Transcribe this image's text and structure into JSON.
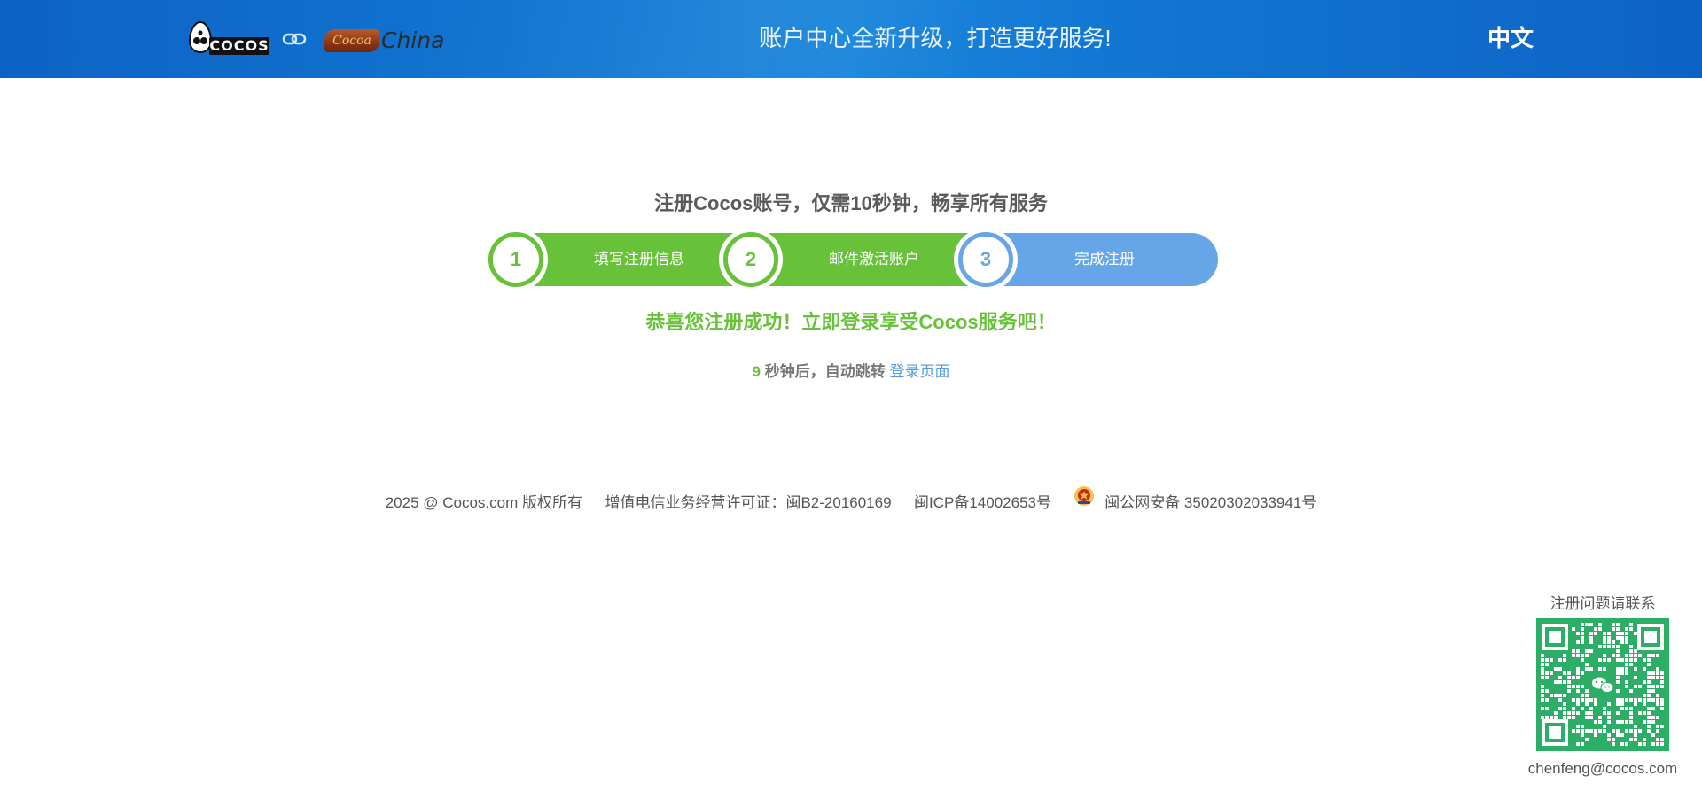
{
  "header": {
    "logo_cocos_text": "COCOS",
    "logo_cocoa_text": "Cocoa",
    "logo_china_text": "China",
    "slogan": "账户中心全新升级，打造更好服务!",
    "language": "中文"
  },
  "main": {
    "title": "注册Cocos账号，仅需10秒钟，畅享所有服务",
    "steps": [
      {
        "number": "1",
        "label": "填写注册信息"
      },
      {
        "number": "2",
        "label": "邮件激活账户"
      },
      {
        "number": "3",
        "label": "完成注册"
      }
    ],
    "success_message": "恭喜您注册成功！立即登录享受Cocos服务吧！",
    "countdown_number": "9",
    "countdown_text": " 秒钟后，自动跳转 ",
    "login_link": "登录页面"
  },
  "footer": {
    "copyright": "2025 @ Cocos.com 版权所有",
    "license": "增值电信业务经营许可证：闽B2-20160169",
    "icp": "闽ICP备14002653号",
    "police_record": "闽公网安备 35020302033941号"
  },
  "contact": {
    "title": "注册问题请联系",
    "email": "chenfeng@cocos.com"
  },
  "colors": {
    "header_blue": "#1277d3",
    "step_green": "#67c23a",
    "step_blue": "#66a6e8",
    "link_blue": "#5a9de0",
    "qr_green": "#2cae66"
  },
  "icons": {
    "link": "link-icon",
    "police": "police-badge-icon",
    "wechat": "wechat-icon"
  }
}
